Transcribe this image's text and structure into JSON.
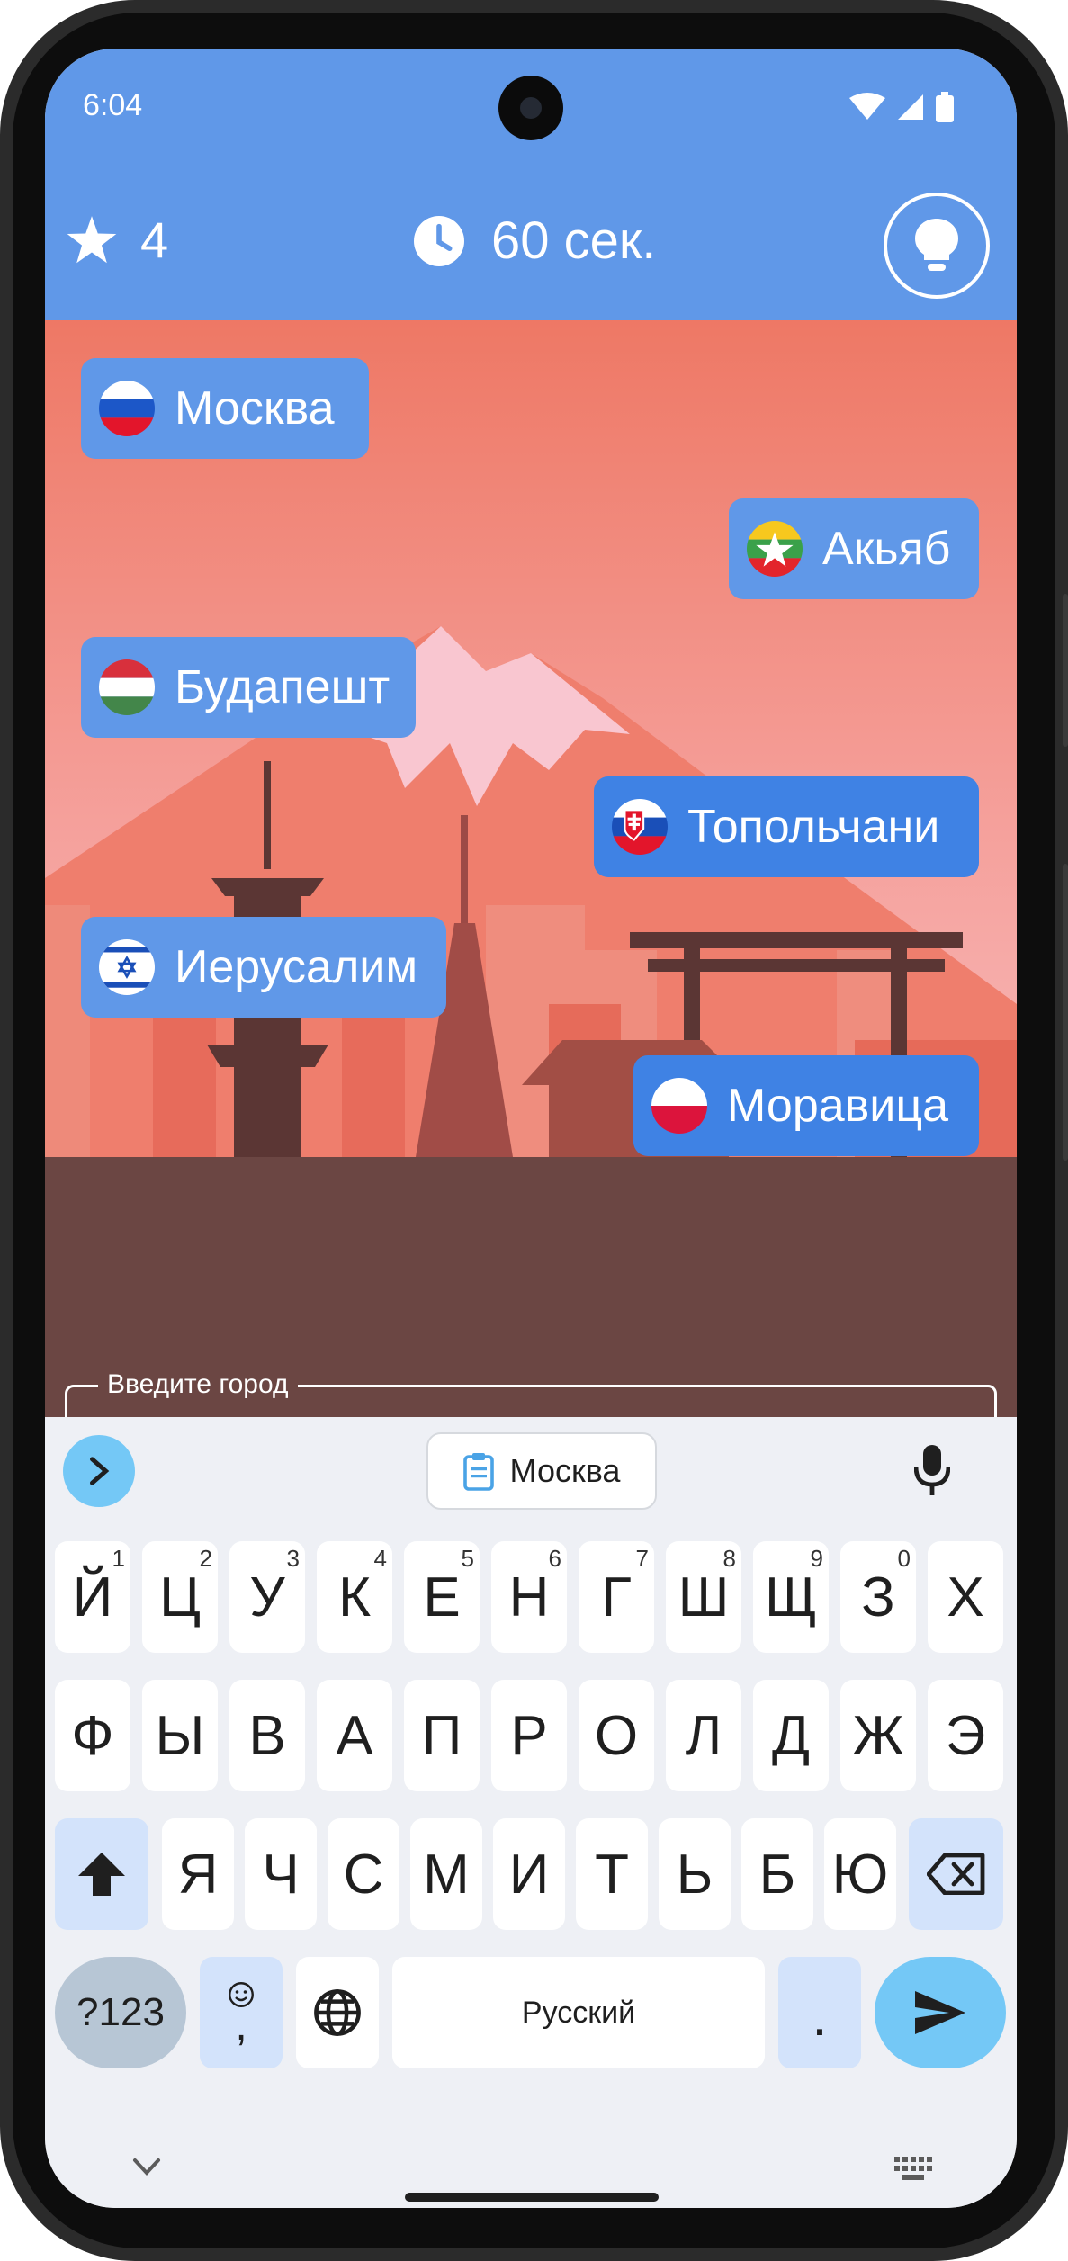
{
  "status": {
    "time": "6:04"
  },
  "header": {
    "score": "4",
    "timer": "60 сек."
  },
  "cities": [
    {
      "name": "Москва",
      "flag": "russia"
    },
    {
      "name": "Акьяб",
      "flag": "myanmar"
    },
    {
      "name": "Будапешт",
      "flag": "hungary"
    },
    {
      "name": "Топольчани",
      "flag": "slovakia"
    },
    {
      "name": "Иерусалим",
      "flag": "israel"
    },
    {
      "name": "Моравица",
      "flag": "poland"
    }
  ],
  "input": {
    "label": "Введите город",
    "value": ""
  },
  "keyboard": {
    "suggestion": "Москва",
    "row1": [
      {
        "key": "Й",
        "num": "1"
      },
      {
        "key": "Ц",
        "num": "2"
      },
      {
        "key": "У",
        "num": "3"
      },
      {
        "key": "К",
        "num": "4"
      },
      {
        "key": "Е",
        "num": "5"
      },
      {
        "key": "Н",
        "num": "6"
      },
      {
        "key": "Г",
        "num": "7"
      },
      {
        "key": "Ш",
        "num": "8"
      },
      {
        "key": "Щ",
        "num": "9"
      },
      {
        "key": "З",
        "num": "0"
      },
      {
        "key": "Х",
        "num": ""
      }
    ],
    "row2": [
      "Ф",
      "Ы",
      "В",
      "А",
      "П",
      "Р",
      "О",
      "Л",
      "Д",
      "Ж",
      "Э"
    ],
    "row3": [
      "Я",
      "Ч",
      "С",
      "М",
      "И",
      "Т",
      "Ь",
      "Б",
      "Ю"
    ],
    "symbols_label": "?123",
    "emoji_comma": ",",
    "space_label": "Русский",
    "period": "."
  },
  "colors": {
    "header": "#6098e8",
    "chip": "#6098e8",
    "chip_active": "#3f82e4",
    "ground": "#6b4643",
    "accent": "#74c8f6"
  }
}
